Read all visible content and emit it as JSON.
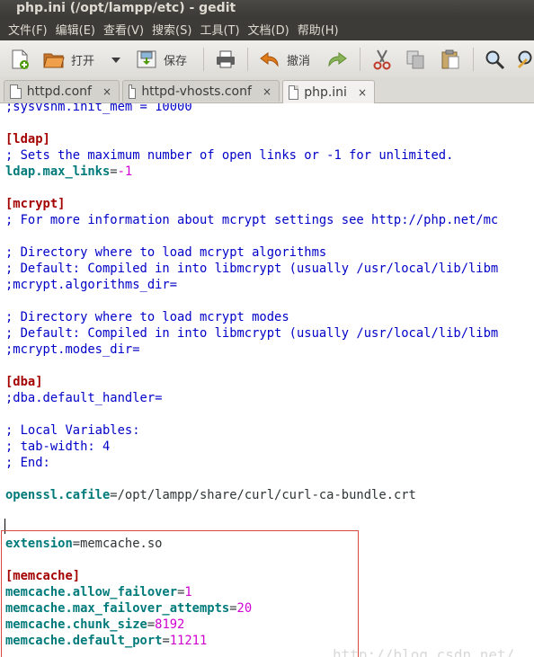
{
  "window": {
    "title": "php.ini (/opt/lampp/etc) - gedit"
  },
  "menu": [
    "文件(F)",
    "编辑(E)",
    "查看(V)",
    "搜索(S)",
    "工具(T)",
    "文档(D)",
    "帮助(H)"
  ],
  "toolbar": {
    "open_label": "打开",
    "save_label": "保存",
    "undo_label": "撤消"
  },
  "tabs": [
    {
      "label": "httpd.conf",
      "close": "×"
    },
    {
      "label": "httpd-vhosts.conf",
      "close": "×"
    },
    {
      "label": "php.ini",
      "close": "×",
      "active": true
    }
  ],
  "editor": {
    "lines": [
      [
        {
          "t": ";sysvshm.init_mem = 10000",
          "c": "comment"
        }
      ],
      [],
      [
        {
          "t": "[ldap]",
          "c": "section"
        }
      ],
      [
        {
          "t": "; Sets the maximum number of open links or -1 for unlimited.",
          "c": "comment"
        }
      ],
      [
        {
          "t": "ldap.max_links",
          "c": "key"
        },
        {
          "t": "=",
          "c": "val"
        },
        {
          "t": "-1",
          "c": "num"
        }
      ],
      [],
      [
        {
          "t": "[mcrypt]",
          "c": "section"
        }
      ],
      [
        {
          "t": "; For more information about mcrypt settings see http://php.net/mc",
          "c": "comment"
        }
      ],
      [],
      [
        {
          "t": "; Directory where to load mcrypt algorithms",
          "c": "comment"
        }
      ],
      [
        {
          "t": "; Default: Compiled in into libmcrypt (usually /usr/local/lib/libm",
          "c": "comment"
        }
      ],
      [
        {
          "t": ";mcrypt.algorithms_dir=",
          "c": "comment"
        }
      ],
      [],
      [
        {
          "t": "; Directory where to load mcrypt modes",
          "c": "comment"
        }
      ],
      [
        {
          "t": "; Default: Compiled in into libmcrypt (usually /usr/local/lib/libm",
          "c": "comment"
        }
      ],
      [
        {
          "t": ";mcrypt.modes_dir=",
          "c": "comment"
        }
      ],
      [],
      [
        {
          "t": "[dba]",
          "c": "section"
        }
      ],
      [
        {
          "t": ";dba.default_handler=",
          "c": "comment"
        }
      ],
      [],
      [
        {
          "t": "; Local Variables:",
          "c": "comment"
        }
      ],
      [
        {
          "t": "; tab-width: 4",
          "c": "comment"
        }
      ],
      [
        {
          "t": "; End:",
          "c": "comment"
        }
      ],
      [],
      [
        {
          "t": "openssl.cafile",
          "c": "key"
        },
        {
          "t": "=/opt/lampp/share/curl/curl-ca-bundle.crt",
          "c": "val"
        }
      ],
      [],
      [],
      [
        {
          "t": "extension",
          "c": "key"
        },
        {
          "t": "=memcache.so",
          "c": "val"
        }
      ],
      [],
      [
        {
          "t": "[memcache]",
          "c": "section"
        }
      ],
      [
        {
          "t": "memcache.allow_failover",
          "c": "key"
        },
        {
          "t": "=",
          "c": "val"
        },
        {
          "t": "1",
          "c": "num"
        }
      ],
      [
        {
          "t": "memcache.max_failover_attempts",
          "c": "key"
        },
        {
          "t": "=",
          "c": "val"
        },
        {
          "t": "20",
          "c": "num"
        }
      ],
      [
        {
          "t": "memcache.chunk_size",
          "c": "key"
        },
        {
          "t": "=",
          "c": "val"
        },
        {
          "t": "8192",
          "c": "num"
        }
      ],
      [
        {
          "t": "memcache.default_port",
          "c": "key"
        },
        {
          "t": "=",
          "c": "val"
        },
        {
          "t": "11211",
          "c": "num"
        }
      ]
    ],
    "watermark": "http://blog.csdn.net/"
  },
  "icons": [
    "new-document-icon",
    "open-folder-icon",
    "dropdown-arrow-icon",
    "save-icon",
    "print-icon",
    "undo-icon",
    "redo-icon",
    "cut-icon",
    "copy-icon",
    "paste-icon",
    "search-icon",
    "replace-icon"
  ]
}
